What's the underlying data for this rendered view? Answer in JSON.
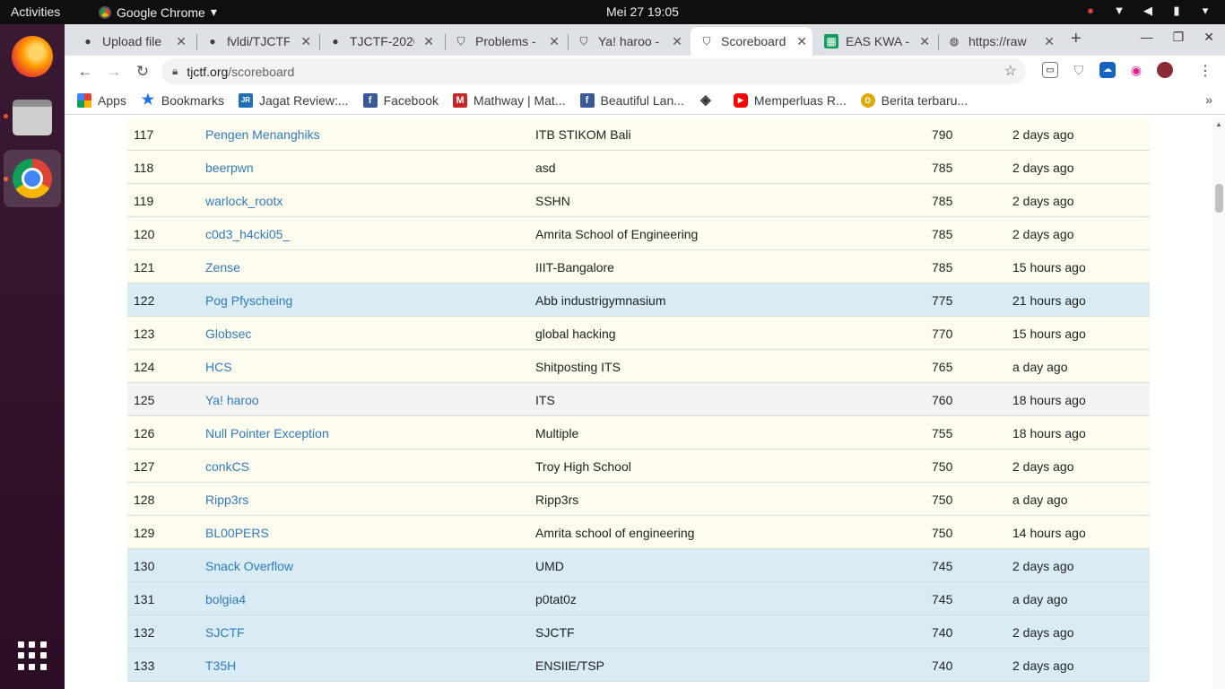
{
  "topbar": {
    "activities": "Activities",
    "app_name": "Google Chrome",
    "app_arrow": "▾",
    "clock": "Mei 27  19:05"
  },
  "tabs": [
    {
      "label": "Upload file",
      "icon": "github-icon"
    },
    {
      "label": "fvldi/TJCTF",
      "icon": "github-icon"
    },
    {
      "label": "TJCTF-2020",
      "icon": "github-icon"
    },
    {
      "label": "Problems -",
      "icon": "tjctf-shield-icon"
    },
    {
      "label": "Ya! haroo -",
      "icon": "tjctf-shield-icon"
    },
    {
      "label": "Scoreboard",
      "icon": "tjctf-shield-icon"
    },
    {
      "label": "EAS KWA -",
      "icon": "sheets-icon"
    },
    {
      "label": "https://raw",
      "icon": "globe-icon"
    }
  ],
  "active_tab_index": 5,
  "address": {
    "host": "tjctf.org",
    "path": "/scoreboard"
  },
  "bookmarks": [
    {
      "label": "Apps",
      "icon": "apps-grid-icon",
      "color": "#4285f4"
    },
    {
      "label": "Bookmarks",
      "icon": "star-icon",
      "color": "#1a73e8"
    },
    {
      "label": "Jagat Review:...",
      "icon": "jr-icon",
      "color": "#1f6fb2"
    },
    {
      "label": "Facebook",
      "icon": "facebook-icon",
      "color": "#3b5998"
    },
    {
      "label": "Mathway | Mat...",
      "icon": "mathway-icon",
      "color": "#c62828"
    },
    {
      "label": "Beautiful Lan...",
      "icon": "facebook-icon",
      "color": "#3b5998"
    },
    {
      "label": "",
      "icon": "diamond-icon",
      "color": "#333333"
    },
    {
      "label": "Memperluas R...",
      "icon": "youtube-icon",
      "color": "#ff0000"
    },
    {
      "label": "Berita terbaru...",
      "icon": "news-icon",
      "color": "#e0a800"
    }
  ],
  "scoreboard": [
    {
      "rank": "117",
      "team": "Pengen Menanghiks",
      "affiliation": "ITB STIKOM Bali",
      "score": "790",
      "time": "2 days ago",
      "style": "cream"
    },
    {
      "rank": "118",
      "team": "beerpwn",
      "affiliation": "asd",
      "score": "785",
      "time": "2 days ago",
      "style": "cream"
    },
    {
      "rank": "119",
      "team": "warlock_rootx",
      "affiliation": "SSHN",
      "score": "785",
      "time": "2 days ago",
      "style": "cream"
    },
    {
      "rank": "120",
      "team": "c0d3_h4cki05_",
      "affiliation": "Amrita School of Engineering",
      "score": "785",
      "time": "2 days ago",
      "style": "cream"
    },
    {
      "rank": "121",
      "team": "Zense",
      "affiliation": "IIIT-Bangalore",
      "score": "785",
      "time": "15 hours ago",
      "style": "cream"
    },
    {
      "rank": "122",
      "team": "Pog Pfyscheing",
      "affiliation": "Abb industrigymnasium",
      "score": "775",
      "time": "21 hours ago",
      "style": "blue"
    },
    {
      "rank": "123",
      "team": "Globsec",
      "affiliation": "global hacking",
      "score": "770",
      "time": "15 hours ago",
      "style": "cream"
    },
    {
      "rank": "124",
      "team": "HCS",
      "affiliation": "Shitposting ITS",
      "score": "765",
      "time": "a day ago",
      "style": "cream"
    },
    {
      "rank": "125",
      "team": "Ya! haroo",
      "affiliation": "ITS",
      "score": "760",
      "time": "18 hours ago",
      "style": "grey"
    },
    {
      "rank": "126",
      "team": "Null Pointer Exception",
      "affiliation": "Multiple",
      "score": "755",
      "time": "18 hours ago",
      "style": "cream"
    },
    {
      "rank": "127",
      "team": "conkCS",
      "affiliation": "Troy High School",
      "score": "750",
      "time": "2 days ago",
      "style": "cream"
    },
    {
      "rank": "128",
      "team": "Ripp3rs",
      "affiliation": "Ripp3rs",
      "score": "750",
      "time": "a day ago",
      "style": "cream"
    },
    {
      "rank": "129",
      "team": "BL00PERS",
      "affiliation": "Amrita school of engineering",
      "score": "750",
      "time": "14 hours ago",
      "style": "cream"
    },
    {
      "rank": "130",
      "team": "Snack Overflow",
      "affiliation": "UMD",
      "score": "745",
      "time": "2 days ago",
      "style": "blue"
    },
    {
      "rank": "131",
      "team": "bolgia4",
      "affiliation": "p0tat0z",
      "score": "745",
      "time": "a day ago",
      "style": "blue"
    },
    {
      "rank": "132",
      "team": "SJCTF",
      "affiliation": "SJCTF",
      "score": "740",
      "time": "2 days ago",
      "style": "blue"
    },
    {
      "rank": "133",
      "team": "T35H",
      "affiliation": "ENSIIE/TSP",
      "score": "740",
      "time": "2 days ago",
      "style": "blue"
    }
  ],
  "colors": {
    "link": "#2f7bbd",
    "row_cream": "#fefcef",
    "row_blue": "#d9ecf5",
    "row_grey": "#f3f3f3"
  }
}
